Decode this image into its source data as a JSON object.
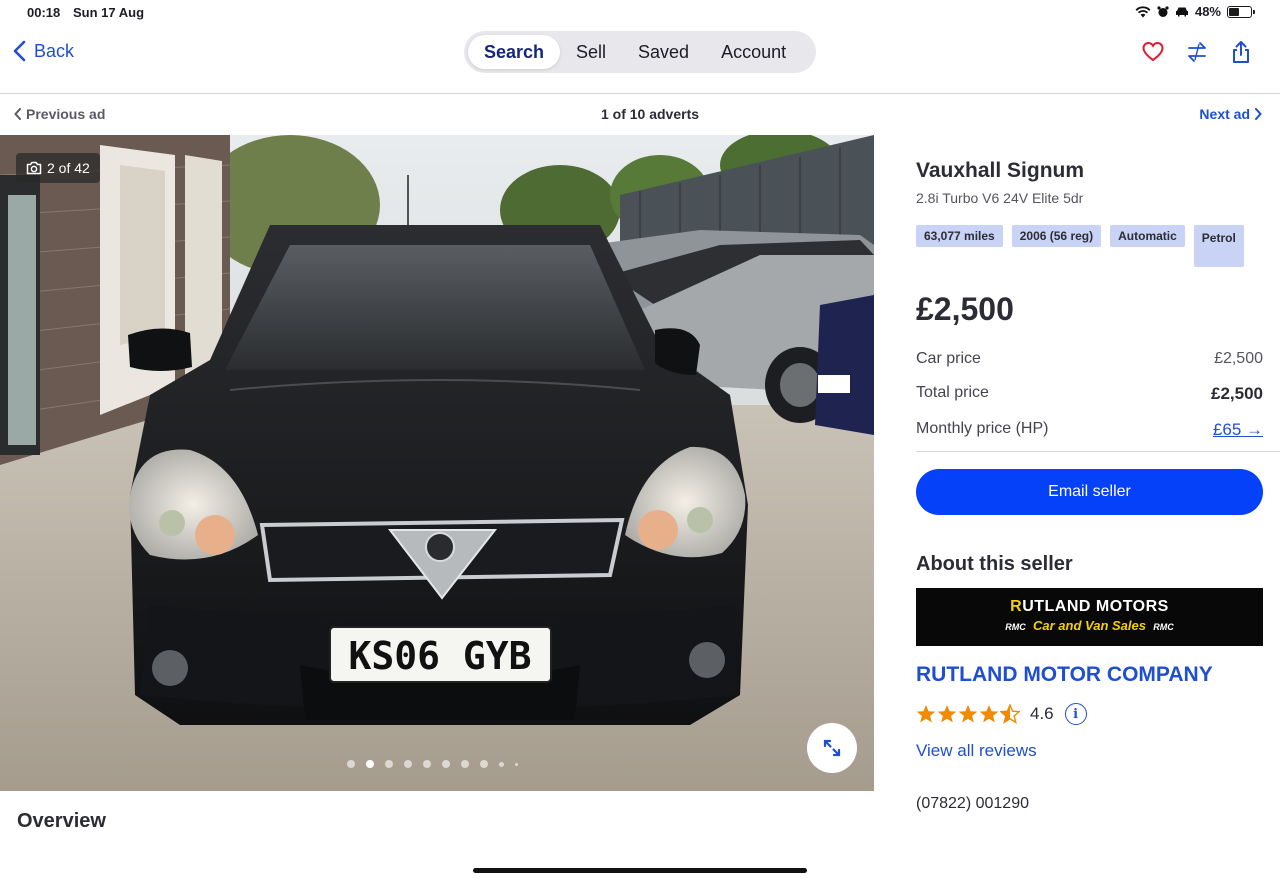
{
  "status_bar": {
    "time": "00:18",
    "date": "Sun 17 Aug",
    "battery": "48%",
    "battery_level": 0.48
  },
  "nav": {
    "back_label": "Back",
    "tabs": [
      {
        "label": "Search",
        "active": true
      },
      {
        "label": "Sell",
        "active": false
      },
      {
        "label": "Saved",
        "active": false
      },
      {
        "label": "Account",
        "active": false
      }
    ],
    "icons": [
      "heart-icon",
      "compare-icon",
      "share-icon"
    ]
  },
  "pager": {
    "previous": "Previous ad",
    "count": "1 of 10 adverts",
    "next": "Next ad"
  },
  "gallery": {
    "counter": "2 of 42",
    "current_index": 2,
    "plate": "KS06 GYB"
  },
  "overview_heading": "Overview",
  "listing": {
    "title": "Vauxhall Signum",
    "subtitle": "2.8i Turbo V6 24V Elite 5dr",
    "specs": [
      "63,077 miles",
      "2006 (56 reg)",
      "Automatic",
      "Petrol"
    ],
    "price": "£2,500",
    "car_price_label": "Car price",
    "car_price_value": "£2,500",
    "total_price_label": "Total price",
    "total_price_value": "£2,500",
    "monthly_label": "Monthly price (HP)",
    "monthly_value": "£65 →",
    "email_button": "Email seller"
  },
  "seller": {
    "heading": "About this seller",
    "logo_line1_initial": "R",
    "logo_line1_rest": "UTLAND MOTORS",
    "logo_line2": "Car and Van Sales",
    "logo_mark": "RMC",
    "name": "RUTLAND MOTOR COMPANY",
    "rating": "4.6",
    "reviews_link": "View all reviews",
    "phone": "(07822) 001290"
  },
  "colors": {
    "accent": "#0441f8",
    "link": "#1f4fd1",
    "spec_chip": "#c8d3f5",
    "star": "#f08a00"
  }
}
